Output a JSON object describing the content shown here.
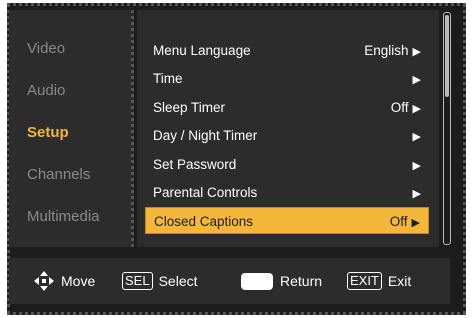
{
  "sidebar": {
    "items": [
      {
        "label": "Video"
      },
      {
        "label": "Audio"
      },
      {
        "label": "Setup"
      },
      {
        "label": "Channels"
      },
      {
        "label": "Multimedia"
      }
    ],
    "active_index": 2
  },
  "menu": {
    "items": [
      {
        "label": "Menu Language",
        "value": "English",
        "arrow": "▶"
      },
      {
        "label": "Time",
        "value": "",
        "arrow": "▶"
      },
      {
        "label": "Sleep Timer",
        "value": "Off",
        "arrow": "▶"
      },
      {
        "label": "Day / Night Timer",
        "value": "",
        "arrow": "▶"
      },
      {
        "label": "Set Password",
        "value": "",
        "arrow": "▶"
      },
      {
        "label": "Parental Controls",
        "value": "",
        "arrow": "▶"
      },
      {
        "label": "Closed Captions",
        "value": "Off",
        "arrow": "▶"
      }
    ],
    "selected_index": 6
  },
  "footer": {
    "move_label": "Move",
    "sel_key": "SEL",
    "select_label": "Select",
    "return_label": "Return",
    "exit_key": "EXIT",
    "exit_label": "Exit"
  },
  "colors": {
    "accent": "#f5b73a",
    "panel": "#2c2c2c",
    "background": "#1c1c1c",
    "inactive_text": "#8a8a8a"
  },
  "icons": {
    "move": "four-way-arrow-icon",
    "return": "return-key-icon",
    "arrow": "play-arrow-icon"
  }
}
